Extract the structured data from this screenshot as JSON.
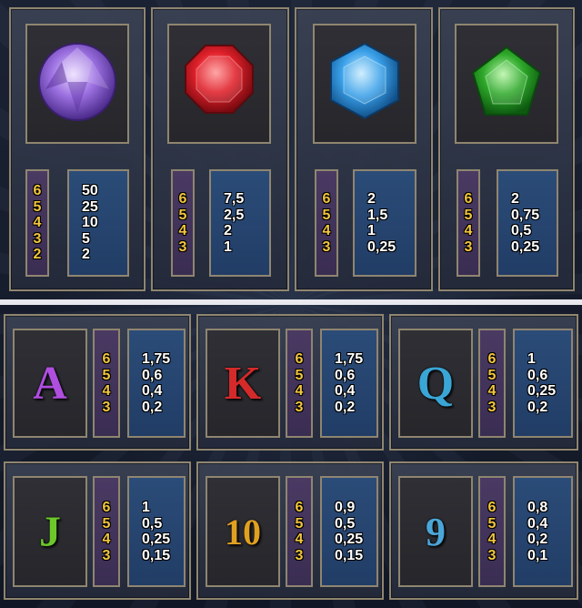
{
  "top_symbols": [
    {
      "icon": "purple-round-gem-icon",
      "color": "#9b6fe0",
      "counts": [
        "6",
        "5",
        "4",
        "3",
        "2"
      ],
      "pays": [
        "50",
        "25",
        "10",
        "5",
        "2"
      ]
    },
    {
      "icon": "red-octagon-gem-icon",
      "color": "#e0202a",
      "counts": [
        "6",
        "5",
        "4",
        "3"
      ],
      "pays": [
        "7,5",
        "2,5",
        "2",
        "1"
      ]
    },
    {
      "icon": "blue-hexagon-gem-icon",
      "color": "#3aa0e8",
      "counts": [
        "6",
        "5",
        "4",
        "3"
      ],
      "pays": [
        "2",
        "1,5",
        "1",
        "0,25"
      ]
    },
    {
      "icon": "green-pentagon-gem-icon",
      "color": "#2ea82a",
      "counts": [
        "6",
        "5",
        "4",
        "3"
      ],
      "pays": [
        "2",
        "0,75",
        "0,5",
        "0,25"
      ]
    }
  ],
  "bottom_symbols": [
    {
      "icon": "letter-a-icon",
      "glyph": "A",
      "color": "#b04ee0",
      "counts": [
        "6",
        "5",
        "4",
        "3"
      ],
      "pays": [
        "1,75",
        "0,6",
        "0,4",
        "0,2"
      ]
    },
    {
      "icon": "letter-k-icon",
      "glyph": "K",
      "color": "#d42a2a",
      "counts": [
        "6",
        "5",
        "4",
        "3"
      ],
      "pays": [
        "1,75",
        "0,6",
        "0,4",
        "0,2"
      ]
    },
    {
      "icon": "letter-q-icon",
      "glyph": "Q",
      "color": "#3aa6d6",
      "counts": [
        "6",
        "5",
        "4",
        "3"
      ],
      "pays": [
        "1",
        "0,6",
        "0,25",
        "0,2"
      ]
    },
    {
      "icon": "letter-j-icon",
      "glyph": "J",
      "color": "#6cc82a",
      "counts": [
        "6",
        "5",
        "4",
        "3"
      ],
      "pays": [
        "1",
        "0,5",
        "0,25",
        "0,15"
      ]
    },
    {
      "icon": "number-10-icon",
      "glyph": "10",
      "color": "#e0a020",
      "counts": [
        "6",
        "5",
        "4",
        "3"
      ],
      "pays": [
        "0,9",
        "0,5",
        "0,25",
        "0,15"
      ]
    },
    {
      "icon": "number-9-icon",
      "glyph": "9",
      "color": "#4aa6d8",
      "counts": [
        "6",
        "5",
        "4",
        "3"
      ],
      "pays": [
        "0,8",
        "0,4",
        "0,2",
        "0,1"
      ]
    }
  ]
}
